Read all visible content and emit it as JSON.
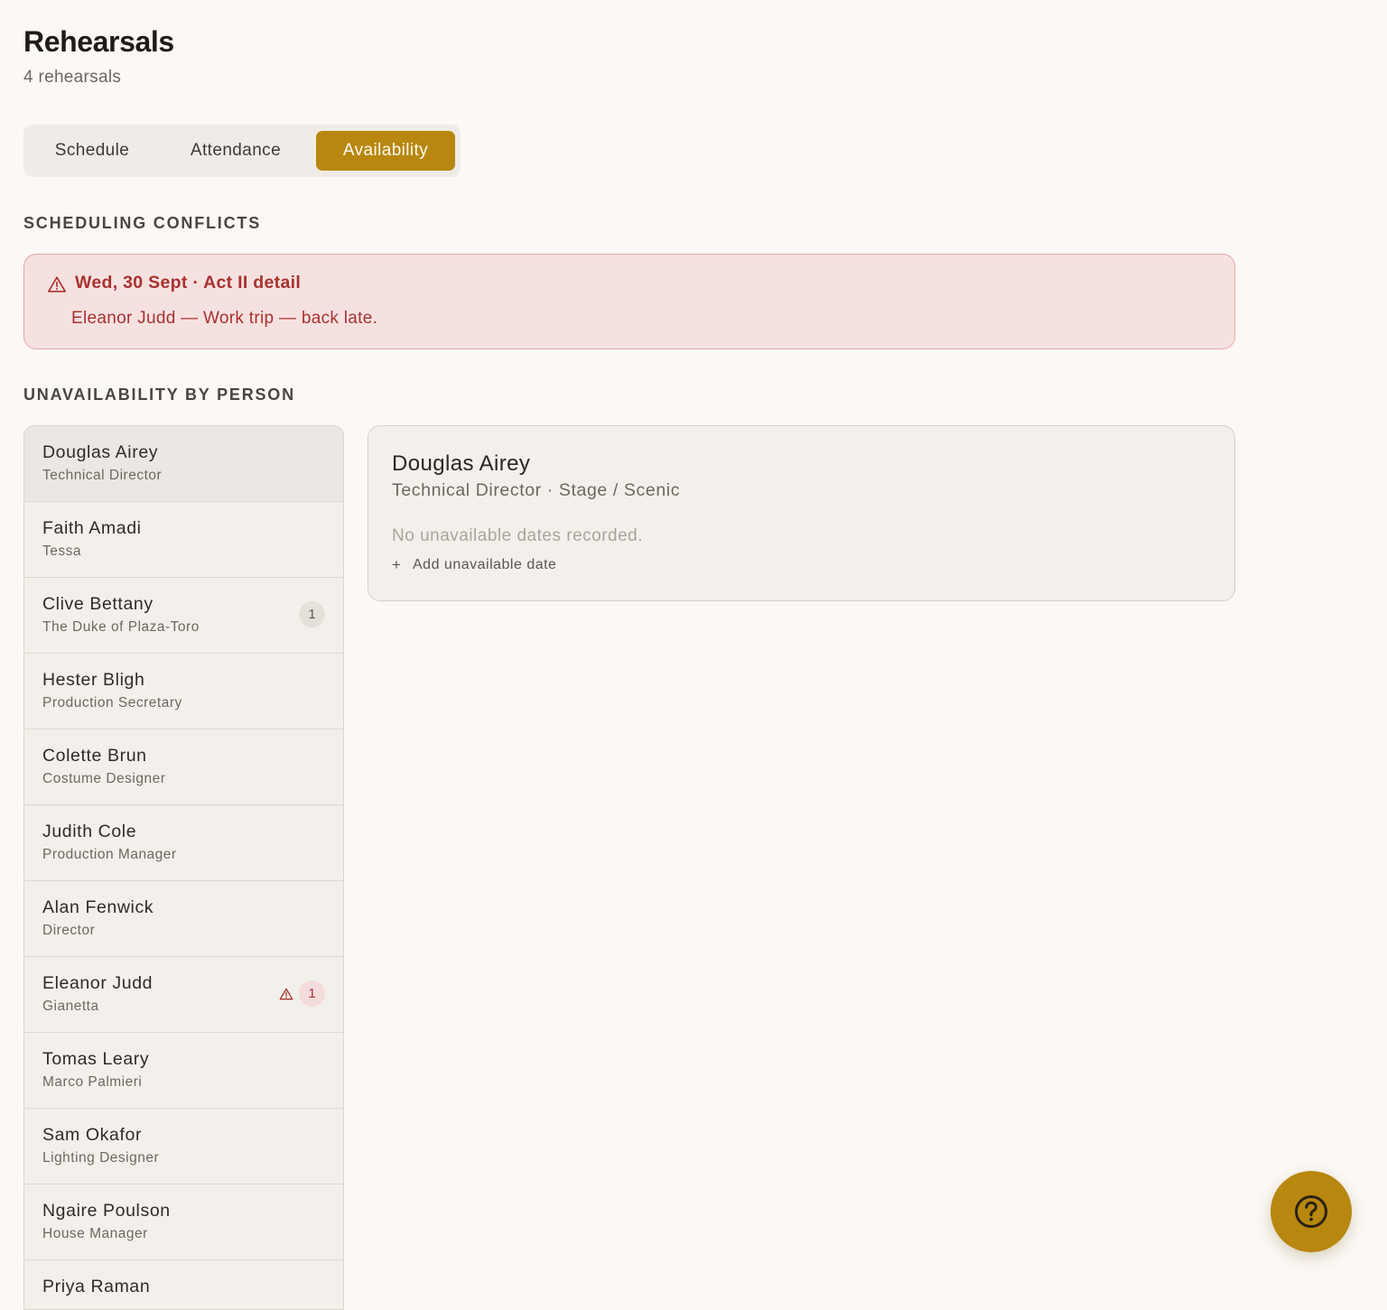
{
  "header": {
    "title": "Rehearsals",
    "subtitle": "4 rehearsals"
  },
  "tabs": [
    {
      "label": "Schedule",
      "active": false
    },
    {
      "label": "Attendance",
      "active": false
    },
    {
      "label": "Availability",
      "active": true
    }
  ],
  "conflicts": {
    "heading": "SCHEDULING CONFLICTS",
    "items": [
      {
        "icon": "warning-icon",
        "title": "Wed, 30 Sept · Act II detail",
        "detail": "Eleanor Judd — Work trip — back late."
      }
    ]
  },
  "unavailability": {
    "heading": "UNAVAILABILITY BY PERSON",
    "people": [
      {
        "name": "Douglas Airey",
        "role": "Technical Director",
        "selected": true
      },
      {
        "name": "Faith Amadi",
        "role": "Tessa"
      },
      {
        "name": "Clive Bettany",
        "role": "The Duke of Plaza-Toro",
        "count": "1"
      },
      {
        "name": "Hester Bligh",
        "role": "Production Secretary"
      },
      {
        "name": "Colette Brun",
        "role": "Costume Designer"
      },
      {
        "name": "Judith Cole",
        "role": "Production Manager"
      },
      {
        "name": "Alan Fenwick",
        "role": "Director"
      },
      {
        "name": "Eleanor Judd",
        "role": "Gianetta",
        "count": "1",
        "conflict": true
      },
      {
        "name": "Tomas Leary",
        "role": "Marco Palmieri"
      },
      {
        "name": "Sam Okafor",
        "role": "Lighting Designer"
      },
      {
        "name": "Ngaire Poulson",
        "role": "House Manager"
      },
      {
        "name": "Priya Raman",
        "role": ""
      }
    ],
    "detail": {
      "name": "Douglas Airey",
      "meta": "Technical Director · Stage / Scenic",
      "empty_text": "No unavailable dates recorded.",
      "add_label": "Add unavailable date"
    }
  },
  "help_button": {
    "icon": "help-question-icon"
  },
  "colors": {
    "accent": "#b8870f",
    "background": "#fbf8f5",
    "conflict_text": "#a8322f",
    "conflict_bg": "#f6e1e1",
    "conflict_border": "#e8a7a7"
  }
}
